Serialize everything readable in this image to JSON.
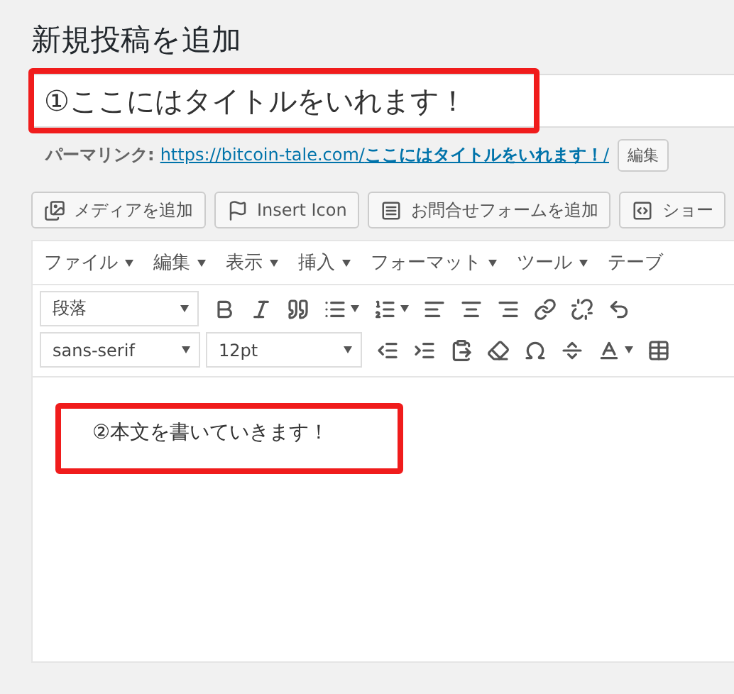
{
  "page_title": "新規投稿を追加",
  "title_field": {
    "value": "①ここにはタイトルをいれます！"
  },
  "permalink": {
    "label": "パーマリンク:",
    "url": "https://bitcoin-tale.com/**ここにはタイトルをいれます！**/",
    "edit_button": "編集"
  },
  "media_buttons": [
    {
      "kind": "media",
      "label": "メディアを追加"
    },
    {
      "kind": "flag",
      "label": "Insert Icon"
    },
    {
      "kind": "form",
      "label": "お問合せフォームを追加"
    },
    {
      "kind": "shortcode",
      "label": "ショー"
    }
  ],
  "menubar": [
    "ファイル",
    "編集",
    "表示",
    "挿入",
    "フォーマット",
    "ツール",
    "テーブ"
  ],
  "toolbar": {
    "format_select": "段落",
    "font_select": "sans-serif",
    "size_select": "12pt"
  },
  "body_text": "②本文を書いていきます！"
}
